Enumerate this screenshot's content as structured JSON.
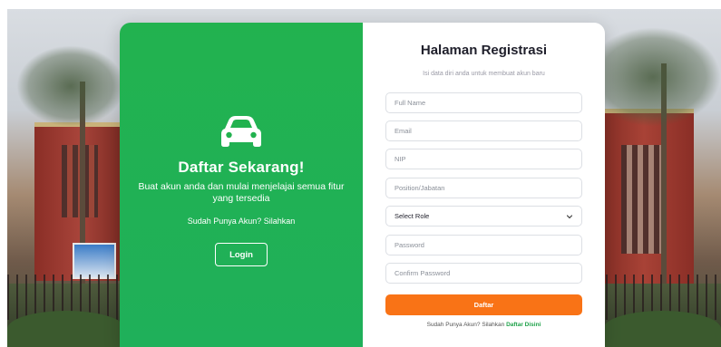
{
  "left_panel": {
    "title": "Daftar Sekarang!",
    "description": "Buat akun anda dan mulai menjelajai semua fitur yang tersedia",
    "have_account_text": "Sudah Punya Akun? Silahkan",
    "login_label": "Login",
    "accent_color": "#22b24f",
    "icon": "car-icon"
  },
  "right_panel": {
    "title": "Halaman Registrasi",
    "subtitle": "Isi data diri anda untuk membuat akun baru",
    "fields": {
      "full_name_placeholder": "Full Name",
      "email_placeholder": "Email",
      "nip_placeholder": "NIP",
      "position_placeholder": "Position/Jabatan",
      "role_selected": "Select Role",
      "password_placeholder": "Password",
      "confirm_password_placeholder": "Confirm Password"
    },
    "submit_label": "Daftar",
    "submit_color": "#f97316",
    "footer_text": "Sudah Punya Akun? Silahkan",
    "footer_link": "Daftar Disini"
  }
}
